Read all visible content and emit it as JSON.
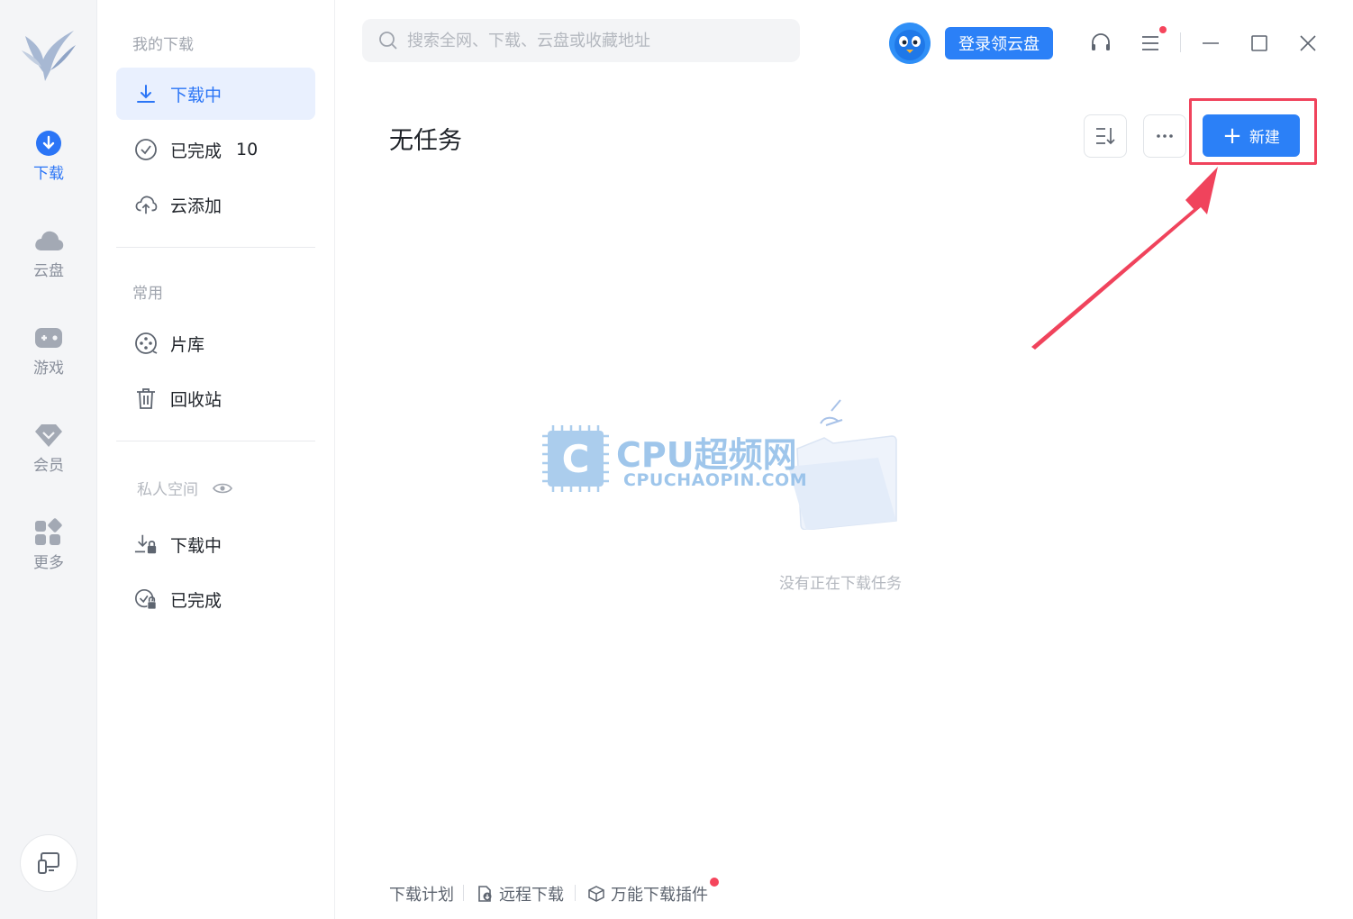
{
  "rail": {
    "items": [
      {
        "label": "下载",
        "icon": "download-icon",
        "active": true
      },
      {
        "label": "云盘",
        "icon": "cloud-icon",
        "active": false
      },
      {
        "label": "游戏",
        "icon": "gamepad-icon",
        "active": false
      },
      {
        "label": "会员",
        "icon": "diamond-icon",
        "active": false
      },
      {
        "label": "更多",
        "icon": "apps-icon",
        "active": false
      }
    ]
  },
  "sidebar": {
    "my_downloads_title": "我的下载",
    "downloading": "下载中",
    "completed": "已完成",
    "completed_count": "10",
    "cloud_add": "云添加",
    "common_title": "常用",
    "library": "片库",
    "recycle": "回收站",
    "private_title": "私人空间",
    "private_downloading": "下载中",
    "private_completed": "已完成"
  },
  "topbar": {
    "search_placeholder": "搜索全网、下载、云盘或收藏地址",
    "login_label": "登录领云盘"
  },
  "main": {
    "title": "无任务",
    "new_label": "新建",
    "empty_text": "没有正在下载任务"
  },
  "watermark": {
    "main": "CPU超频网",
    "sub": "CPUCHAOPIN.COM"
  },
  "footer": {
    "plan": "下载计划",
    "remote": "远程下载",
    "plugin": "万能下载插件"
  },
  "colors": {
    "accent": "#2b80f7",
    "highlight": "#f0435c",
    "badge": "#f5455c"
  }
}
